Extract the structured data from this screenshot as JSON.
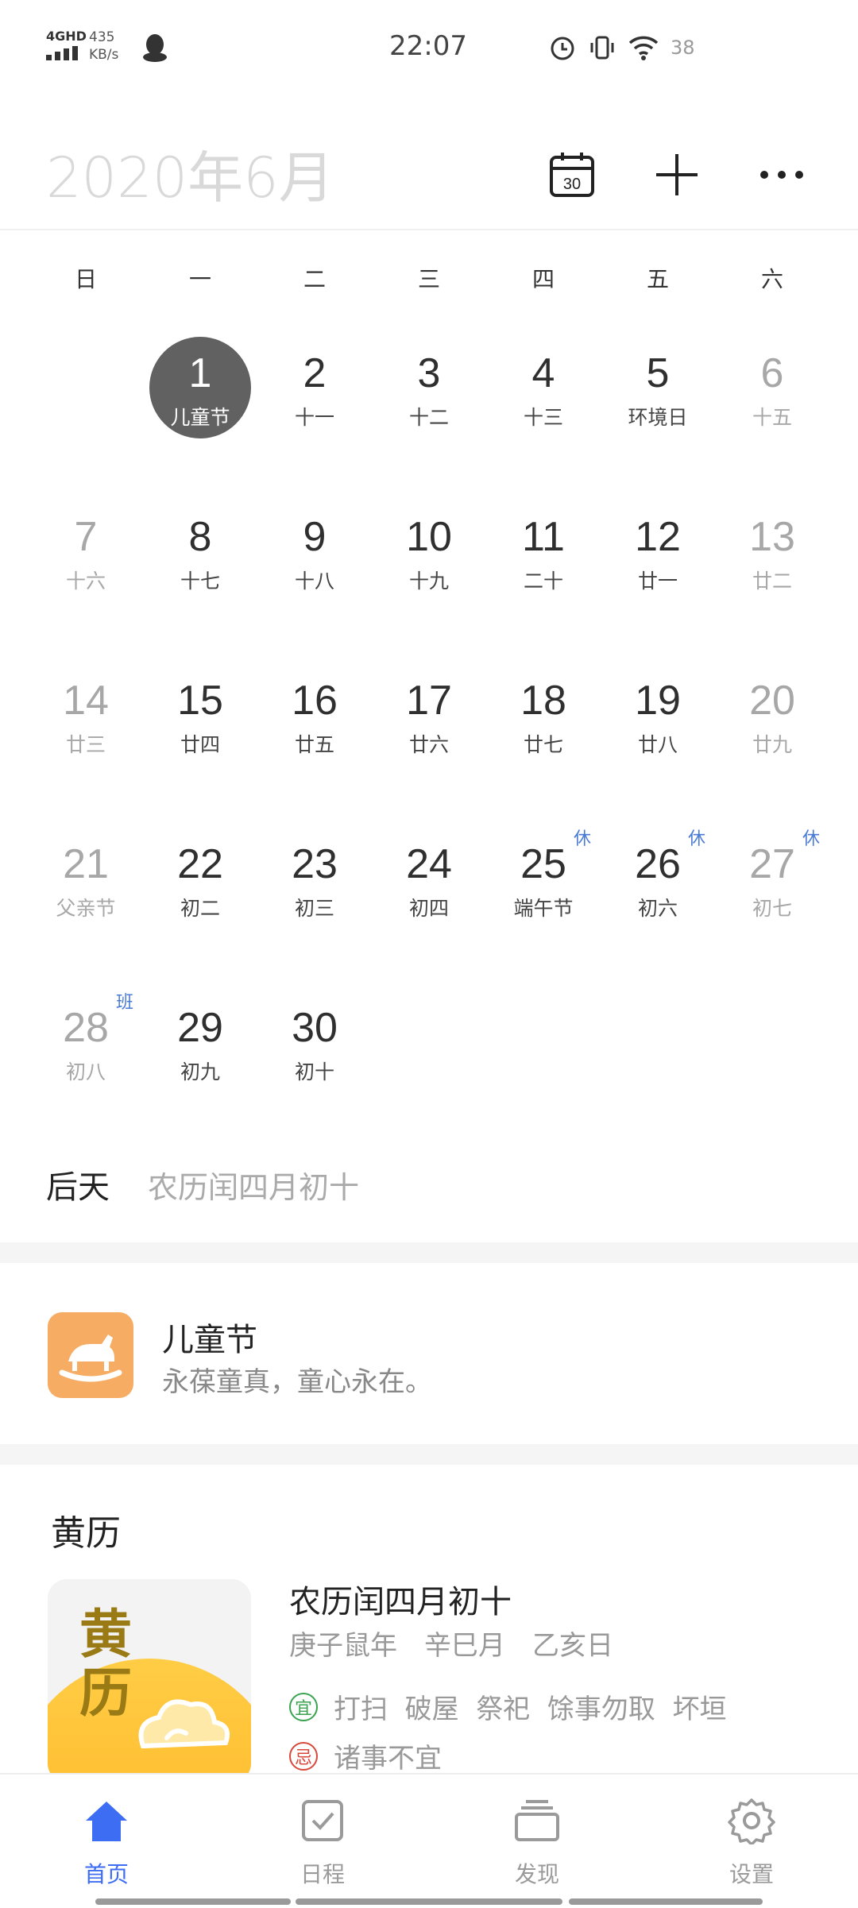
{
  "status": {
    "network": "4GHD",
    "speed_value": "435",
    "speed_unit": "KB/s",
    "time": "22:07",
    "battery": "38"
  },
  "header": {
    "title": "2020年6月",
    "today_icon_text": "30"
  },
  "weekdays": [
    "日",
    "一",
    "二",
    "三",
    "四",
    "五",
    "六"
  ],
  "calendar": {
    "weeks": [
      [
        null,
        {
          "d": "1",
          "sub": "儿童节",
          "selected": true
        },
        {
          "d": "2",
          "sub": "十一"
        },
        {
          "d": "3",
          "sub": "十二"
        },
        {
          "d": "4",
          "sub": "十三"
        },
        {
          "d": "5",
          "sub": "环境日"
        },
        {
          "d": "6",
          "sub": "十五",
          "muted": true
        }
      ],
      [
        {
          "d": "7",
          "sub": "十六",
          "muted": true
        },
        {
          "d": "8",
          "sub": "十七"
        },
        {
          "d": "9",
          "sub": "十八"
        },
        {
          "d": "10",
          "sub": "十九"
        },
        {
          "d": "11",
          "sub": "二十"
        },
        {
          "d": "12",
          "sub": "廿一"
        },
        {
          "d": "13",
          "sub": "廿二",
          "muted": true
        }
      ],
      [
        {
          "d": "14",
          "sub": "廿三",
          "muted": true
        },
        {
          "d": "15",
          "sub": "廿四"
        },
        {
          "d": "16",
          "sub": "廿五"
        },
        {
          "d": "17",
          "sub": "廿六"
        },
        {
          "d": "18",
          "sub": "廿七"
        },
        {
          "d": "19",
          "sub": "廿八"
        },
        {
          "d": "20",
          "sub": "廿九",
          "muted": true
        }
      ],
      [
        {
          "d": "21",
          "sub": "父亲节",
          "muted": true
        },
        {
          "d": "22",
          "sub": "初二"
        },
        {
          "d": "23",
          "sub": "初三"
        },
        {
          "d": "24",
          "sub": "初四"
        },
        {
          "d": "25",
          "sub": "端午节",
          "badge": "休"
        },
        {
          "d": "26",
          "sub": "初六",
          "badge": "休"
        },
        {
          "d": "27",
          "sub": "初七",
          "muted": true,
          "badge": "休"
        }
      ],
      [
        {
          "d": "28",
          "sub": "初八",
          "muted": true,
          "badge": "班"
        },
        {
          "d": "29",
          "sub": "初九"
        },
        {
          "d": "30",
          "sub": "初十"
        },
        null,
        null,
        null,
        null
      ]
    ]
  },
  "info": {
    "day": "后天",
    "lunar": "农历闰四月初十"
  },
  "festival": {
    "name": "儿童节",
    "desc": "永葆童真，童心永在。"
  },
  "almanac": {
    "title": "黄历",
    "image_text": "黄\n历",
    "lunar": "农历闰四月初十",
    "ganzhi": "庚子鼠年　辛巳月　乙亥日",
    "yi_tag": "宜",
    "yi": "打扫  破屋  祭祀  馀事勿取  坏垣",
    "ji_tag": "忌",
    "ji": "诸事不宜"
  },
  "nav": [
    {
      "label": "首页",
      "icon": "home-icon",
      "active": true
    },
    {
      "label": "日程",
      "icon": "schedule-check-icon"
    },
    {
      "label": "发现",
      "icon": "discover-stack-icon"
    },
    {
      "label": "设置",
      "icon": "settings-gear-icon"
    }
  ],
  "colors": {
    "accent": "#3d6df2",
    "selected": "#616161",
    "badge": "#4a7bd6",
    "festival_icon": "#f7ac63"
  }
}
